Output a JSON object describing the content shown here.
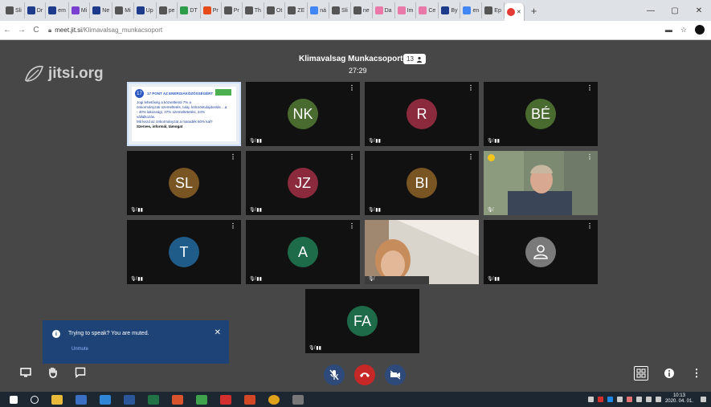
{
  "browser": {
    "tabs": [
      {
        "label": "Sli",
        "color": "#555555"
      },
      {
        "label": "Dr",
        "color": "#1e3a8a"
      },
      {
        "label": "em",
        "color": "#1e3a8a"
      },
      {
        "label": "Mi",
        "color": "#7a3fd0"
      },
      {
        "label": "Ne",
        "color": "#1e3a8a"
      },
      {
        "label": "Mi",
        "color": "#555555"
      },
      {
        "label": "Up",
        "color": "#1e3a8a"
      },
      {
        "label": "pe",
        "color": "#555555"
      },
      {
        "label": "DT",
        "color": "#2e9d4a"
      },
      {
        "label": "Pr",
        "color": "#e64a19"
      },
      {
        "label": "Pr",
        "color": "#555555"
      },
      {
        "label": "Th",
        "color": "#555555"
      },
      {
        "label": "Ot",
        "color": "#555555"
      },
      {
        "label": "ZE",
        "color": "#555555"
      },
      {
        "label": "ná",
        "color": "#4285f4"
      },
      {
        "label": "Sli",
        "color": "#555555"
      },
      {
        "label": "ne",
        "color": "#555555"
      },
      {
        "label": "Da",
        "color": "#e879a8"
      },
      {
        "label": "Im",
        "color": "#e879a8"
      },
      {
        "label": "Ce",
        "color": "#e879a8"
      },
      {
        "label": "By",
        "color": "#1e3a8a"
      },
      {
        "label": "en",
        "color": "#4285f4"
      },
      {
        "label": "Ep",
        "color": "#555555"
      }
    ],
    "active_tab_color": "#e53935",
    "url_host": "meet.jit.si",
    "url_path": "/Klimavalsag_munkacsoport"
  },
  "meeting": {
    "logo_text": "jitsi.org",
    "title": "Klimavalsag Munkacsoport",
    "participant_count": "13",
    "timer": "27:29"
  },
  "tiles": {
    "shared_slide": {
      "title": "17 PONT AZ ENERGIAKÖZÖSSÉGÉRT",
      "lines": [
        "Jogi lehetőség a közvetlenül 7% a",
        "önkormányzati üzemeltetés, tulaj. kölcsöntulajdonlás ...a",
        "- 40% lakossági, 37% üzemeltetetési, 24%",
        "vállalkozás.",
        "Mit kezd az önkormányzat a maradék 60% kal?",
        "Szerves, informál, támogat"
      ]
    },
    "nk": {
      "initials": "NK",
      "color": "#4a6b30"
    },
    "r": {
      "initials": "R",
      "color": "#8a2a3c"
    },
    "be": {
      "initials": "BÉ",
      "color": "#4a6b30"
    },
    "sl": {
      "initials": "SL",
      "color": "#7a5524"
    },
    "jz": {
      "initials": "JZ",
      "color": "#8a2a3c"
    },
    "bi": {
      "initials": "BI",
      "color": "#7a5524"
    },
    "t": {
      "initials": "T",
      "color": "#1f5c8a"
    },
    "a": {
      "initials": "A",
      "color": "#1e6b4a"
    },
    "fa": {
      "initials": "FA",
      "color": "#1e6b4a"
    },
    "generic_avatar_color": "#7a7a7a"
  },
  "toast": {
    "message": "Trying to speak? You are muted.",
    "action": "Unmute",
    "bg": "#1e4477"
  },
  "controls": {
    "hangup_color": "#c62828",
    "toggle_color": "#2d4a7a"
  },
  "taskbar": {
    "time": "10:13",
    "date": "2020. 04. 01."
  }
}
